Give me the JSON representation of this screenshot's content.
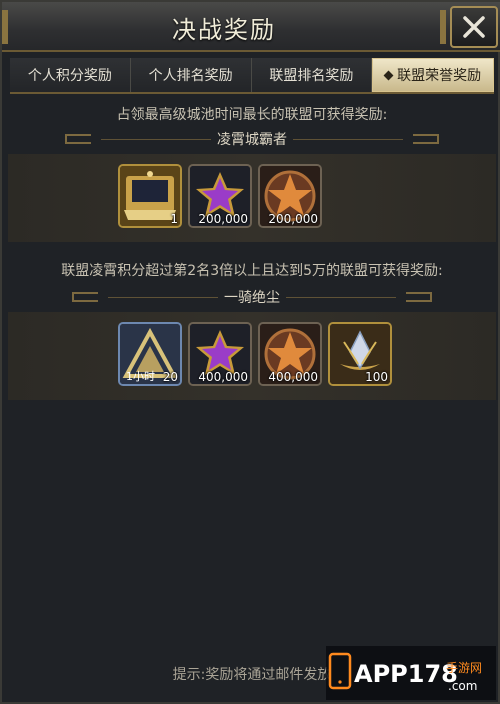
{
  "window": {
    "title": "决战奖励"
  },
  "tabs": [
    {
      "label": "个人积分奖励",
      "active": false
    },
    {
      "label": "个人排名奖励",
      "active": false
    },
    {
      "label": "联盟排名奖励",
      "active": false
    },
    {
      "label": "联盟荣誉奖励",
      "active": true
    }
  ],
  "sections": [
    {
      "description": "占领最高级城池时间最长的联盟可获得奖励:",
      "subtitle": "凌霄城霸者",
      "items": [
        {
          "icon": "treasure-chest-icon",
          "qty": "1"
        },
        {
          "icon": "purple-star-icon",
          "qty": "200,000"
        },
        {
          "icon": "orange-star-medal-icon",
          "qty": "200,000"
        }
      ]
    },
    {
      "description": "联盟凌霄积分超过第2名3倍以上且达到5万的联盟可获得奖励:",
      "subtitle": "一骑绝尘",
      "items": [
        {
          "icon": "speedup-icon",
          "qty": "20",
          "label": "1小时"
        },
        {
          "icon": "purple-star-icon",
          "qty": "400,000"
        },
        {
          "icon": "orange-star-medal-icon",
          "qty": "400,000"
        },
        {
          "icon": "crystal-icon",
          "qty": "100"
        }
      ]
    }
  ],
  "hint": "提示:奖励将通过邮件发放",
  "watermark": {
    "text": "APP178",
    "sub": "手游网",
    "domain": ".com"
  },
  "colors": {
    "accent_gold": "#a58d55",
    "panel": "#1f2226",
    "active_tab": "#efe6c8"
  }
}
